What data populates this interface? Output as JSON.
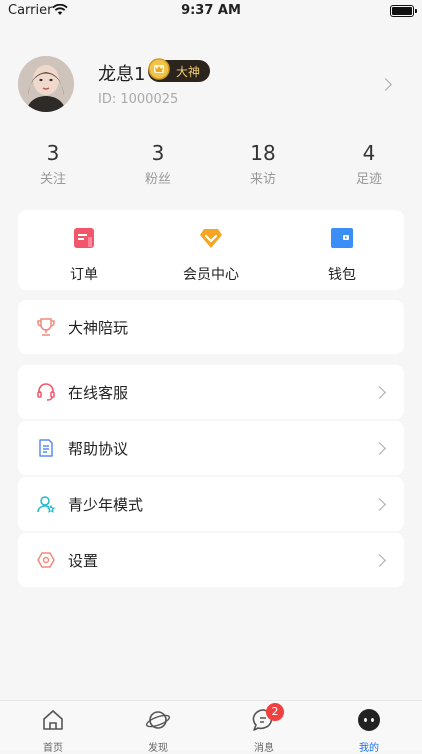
{
  "status_bar": {
    "carrier": "Carrier",
    "time": "9:37 AM"
  },
  "profile": {
    "nickname": "龙息1",
    "badge_label": "大神",
    "user_id": "ID: 1000025"
  },
  "stats": [
    {
      "value": "3",
      "label": "关注"
    },
    {
      "value": "3",
      "label": "粉丝"
    },
    {
      "value": "18",
      "label": "来访"
    },
    {
      "value": "4",
      "label": "足迹"
    }
  ],
  "quick_actions": [
    {
      "label": "订单",
      "icon": "order-icon"
    },
    {
      "label": "会员中心",
      "icon": "vip-diamond-icon"
    },
    {
      "label": "钱包",
      "icon": "wallet-icon"
    }
  ],
  "menu": {
    "companion": "大神陪玩",
    "service": "在线客服",
    "help": "帮助协议",
    "teen": "青少年模式",
    "settings": "设置"
  },
  "tabbar": {
    "items": [
      {
        "label": "首页",
        "icon": "home-icon"
      },
      {
        "label": "发现",
        "icon": "planet-icon"
      },
      {
        "label": "消息",
        "icon": "message-icon",
        "badge": "2"
      },
      {
        "label": "我的",
        "icon": "profile-icon"
      }
    ],
    "active_index": 3
  },
  "colors": {
    "accent": "#1a73e8",
    "badge_red": "#f24040",
    "order_red": "#f2566b",
    "vip_orange": "#f5a623",
    "wallet_blue": "#3a8ef5"
  }
}
